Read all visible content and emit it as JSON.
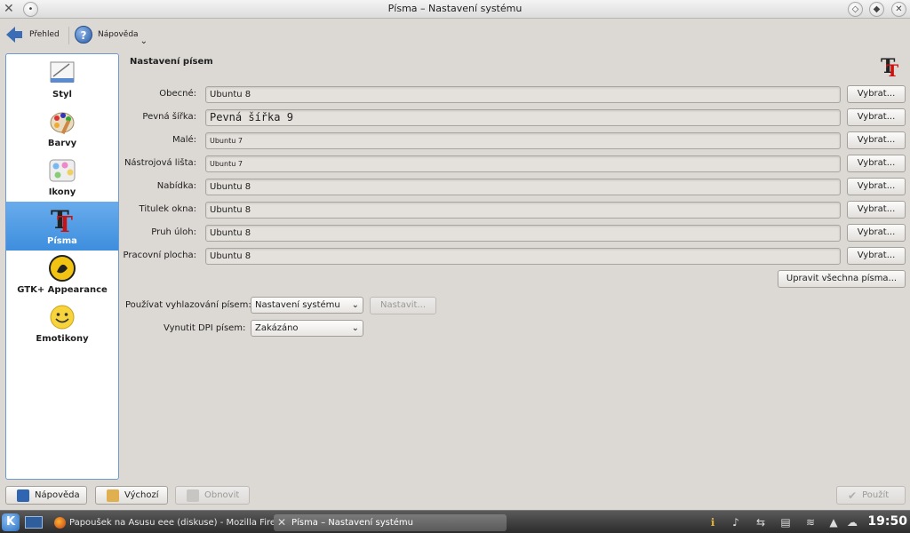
{
  "window": {
    "title": "Písma – Nastavení systému"
  },
  "toolbar": {
    "back_label": "Přehled",
    "help_label": "Nápověda"
  },
  "sidebar": {
    "items": [
      {
        "label": "Styl",
        "icon": "style-icon",
        "active": false
      },
      {
        "label": "Barvy",
        "icon": "colors-icon",
        "active": false
      },
      {
        "label": "Ikony",
        "icon": "icons-icon",
        "active": false
      },
      {
        "label": "Písma",
        "icon": "fonts-icon",
        "active": true
      },
      {
        "label": "GTK+ Appearance",
        "icon": "gtk-icon",
        "active": false
      },
      {
        "label": "Emotikony",
        "icon": "emoticons-icon",
        "active": false
      }
    ]
  },
  "main": {
    "section_title": "Nastavení písem",
    "choose_label": "Vybrat...",
    "rows": [
      {
        "label": "Obecné:",
        "value": "Ubuntu 8"
      },
      {
        "label": "Pevná šířka:",
        "value": "Pevná šířka 9"
      },
      {
        "label": "Malé:",
        "value": "Ubuntu 7"
      },
      {
        "label": "Nástrojová lišta:",
        "value": "Ubuntu 7"
      },
      {
        "label": "Nabídka:",
        "value": "Ubuntu 8"
      },
      {
        "label": "Titulek okna:",
        "value": "Ubuntu 8"
      },
      {
        "label": "Pruh úloh:",
        "value": "Ubuntu 8"
      },
      {
        "label": "Pracovní plocha:",
        "value": "Ubuntu 8"
      }
    ],
    "adjust_all_label": "Upravit všechna písma...",
    "antialias": {
      "label": "Používat vyhlazování písem:",
      "value": "Nastavení systému",
      "configure_label": "Nastavit..."
    },
    "dpi": {
      "label": "Vynutit DPI písem:",
      "value": "Zakázáno"
    }
  },
  "footer": {
    "help": "Nápověda",
    "defaults": "Výchozí",
    "reset": "Obnovit",
    "apply": "Použít"
  },
  "taskbar": {
    "tasks": [
      {
        "label": "Papoušek na Asusu eee (diskuse) - Mozilla Firefox",
        "icon": "firefox-icon"
      },
      {
        "label": "Písma – Nastavení systému",
        "icon": "system-settings-icon"
      }
    ],
    "clock": "19:50"
  },
  "colors": {
    "accent": "#3d8ede",
    "window_bg": "#dcd8d4",
    "taskbar_bg": "#2b2b2b"
  }
}
